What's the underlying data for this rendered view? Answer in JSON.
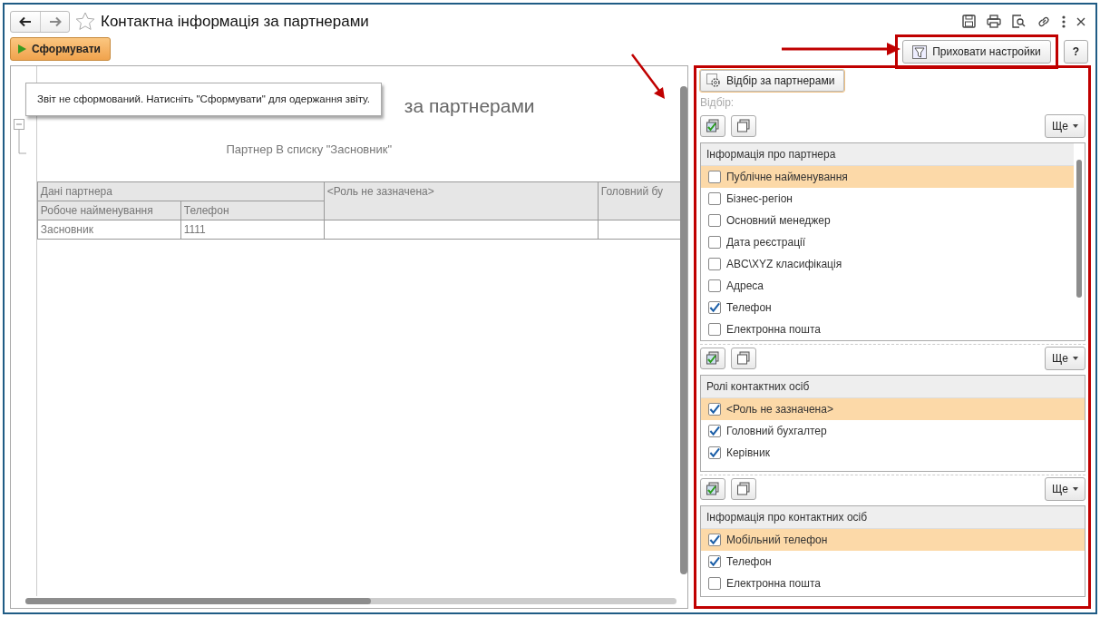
{
  "window": {
    "title": "Контактна інформація за партнерами"
  },
  "toolbar": {
    "generate_button": "Сформувати",
    "settings_button": "Приховати настройки",
    "help_button": "?"
  },
  "report": {
    "title": "за партнерами",
    "filter_text": "Партнер В списку \"Засновник\"",
    "tooltip": "Звіт не сформований. Натисніть \"Сформувати\" для одержання звіту.",
    "group_headers": [
      "Дані партнера",
      "<Роль не зазначена>",
      "Головний бу"
    ],
    "columns": [
      "Робоче найменування",
      "Телефон"
    ],
    "rows": [
      [
        "Засновник",
        "1111"
      ]
    ]
  },
  "settings": {
    "filter_button": "Відбір за партнерами",
    "filter_label": "Відбір:",
    "lists": [
      {
        "more_button": "Ще",
        "header": "Інформація про партнера",
        "scrollable": true,
        "items": [
          {
            "label": "Публічне найменування",
            "checked": false,
            "selected": true
          },
          {
            "label": "Бізнес-регіон",
            "checked": false,
            "selected": false
          },
          {
            "label": "Основний менеджер",
            "checked": false,
            "selected": false
          },
          {
            "label": "Дата реєстрації",
            "checked": false,
            "selected": false
          },
          {
            "label": "ABC\\XYZ класифікація",
            "checked": false,
            "selected": false
          },
          {
            "label": "Адреса",
            "checked": false,
            "selected": false
          },
          {
            "label": "Телефон",
            "checked": true,
            "selected": false
          },
          {
            "label": "Електронна пошта",
            "checked": false,
            "selected": false
          }
        ]
      },
      {
        "more_button": "Ще",
        "header": "Ролі контактних осіб",
        "scrollable": false,
        "items": [
          {
            "label": "<Роль не зазначена>",
            "checked": true,
            "selected": true
          },
          {
            "label": "Головний бухгалтер",
            "checked": true,
            "selected": false
          },
          {
            "label": "Керівник",
            "checked": true,
            "selected": false
          }
        ]
      },
      {
        "more_button": "Ще",
        "header": "Інформація про контактних осіб",
        "scrollable": false,
        "items": [
          {
            "label": "Мобільний телефон",
            "checked": true,
            "selected": true
          },
          {
            "label": "Телефон",
            "checked": true,
            "selected": false
          },
          {
            "label": "Електронна пошта",
            "checked": false,
            "selected": false
          }
        ]
      }
    ]
  }
}
